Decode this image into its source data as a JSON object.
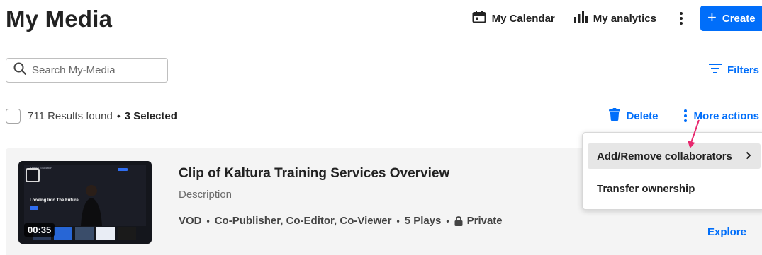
{
  "page": {
    "title": "My Media"
  },
  "header": {
    "calendar_label": "My Calendar",
    "analytics_label": "My analytics",
    "create_label": "Create"
  },
  "search": {
    "placeholder": "Search My-Media",
    "value": ""
  },
  "filters": {
    "label": "Filters"
  },
  "results": {
    "count_text": "711 Results found",
    "selected_text": "3 Selected"
  },
  "bulk_actions": {
    "delete_label": "Delete",
    "more_label": "More actions"
  },
  "more_actions_menu": {
    "items": [
      {
        "label": "Add/Remove collaborators",
        "has_submenu": true,
        "highlighted": true
      },
      {
        "label": "Transfer ownership",
        "has_submenu": false,
        "highlighted": false
      }
    ]
  },
  "entry": {
    "title": "Clip of Kaltura Training Services Overview",
    "description": "Description",
    "duration": "00:35",
    "meta": [
      "VOD",
      "Co-Publisher, Co-Editor, Co-Viewer",
      "5 Plays"
    ],
    "privacy": "Private",
    "explore_label": "Explore",
    "thumbnail": {
      "header_text": "Kaltura Education",
      "headline": "Looking Into The Future"
    }
  },
  "icons": {
    "calendar": "calendar-icon",
    "analytics": "bar-chart-icon",
    "more": "kebab-icon",
    "plus": "plus-icon",
    "search": "search-icon",
    "filters": "filter-lines-icon",
    "delete": "trash-icon",
    "lock": "lock-icon",
    "chevron": "chevron-right-icon",
    "annotation": "pink-arrow-icon"
  },
  "colors": {
    "accent": "#006efa",
    "text": "#222222",
    "muted": "#6b6b6b",
    "entry_bg": "#f4f4f4",
    "menu_highlight": "#e6e6e6",
    "annotation": "#e8286e"
  }
}
